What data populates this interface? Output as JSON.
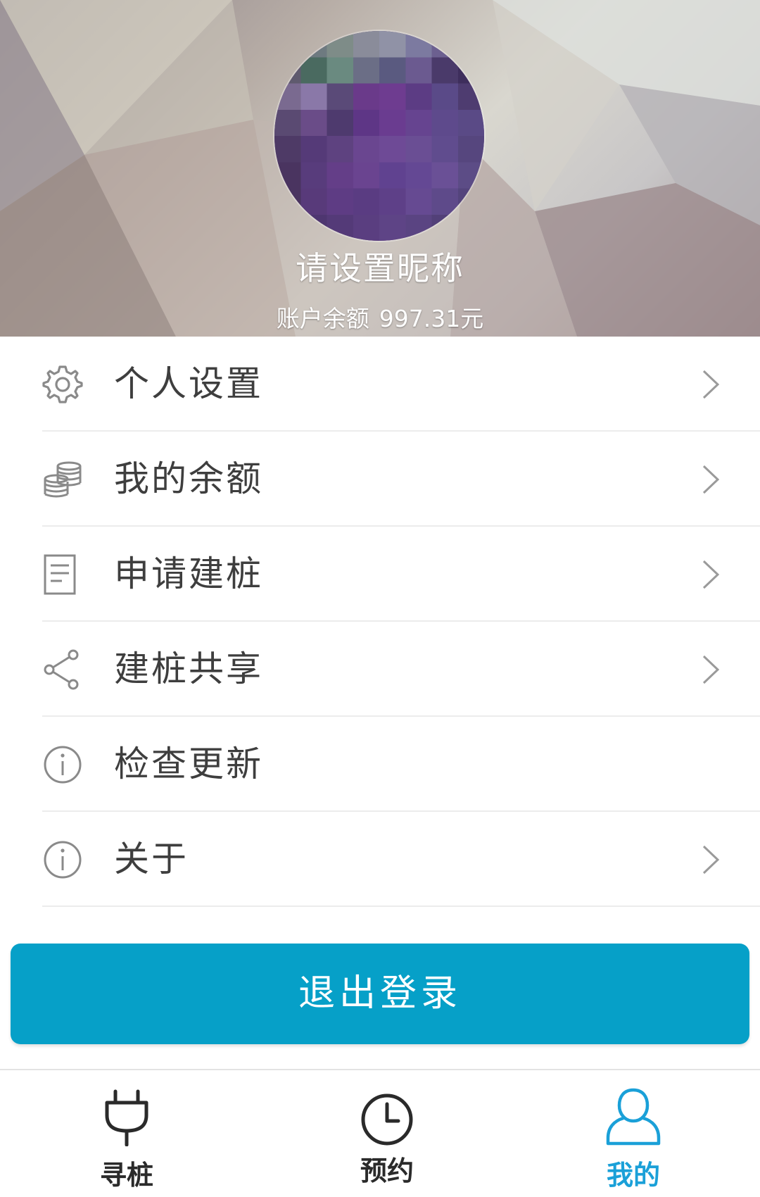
{
  "profile": {
    "nickname": "请设置昵称",
    "balance_label": "账户余额",
    "balance_value": "997.31元"
  },
  "menu": [
    {
      "label": "个人设置",
      "icon": "gear-icon",
      "chevron": true
    },
    {
      "label": "我的余额",
      "icon": "coins-icon",
      "chevron": true
    },
    {
      "label": "申请建桩",
      "icon": "document-icon",
      "chevron": true
    },
    {
      "label": "建桩共享",
      "icon": "share-icon",
      "chevron": true
    },
    {
      "label": "检查更新",
      "icon": "info-icon",
      "chevron": false
    },
    {
      "label": "关于",
      "icon": "info-icon",
      "chevron": true
    }
  ],
  "logout_label": "退出登录",
  "tabs": [
    {
      "label": "寻桩",
      "icon": "plug-icon",
      "active": false
    },
    {
      "label": "预约",
      "icon": "clock-icon",
      "active": false
    },
    {
      "label": "我的",
      "icon": "user-icon",
      "active": true
    }
  ],
  "colors": {
    "accent": "#06a0c8",
    "active_tab": "#1aa0d8",
    "text": "#3e3e3e",
    "divider": "#ececec"
  }
}
